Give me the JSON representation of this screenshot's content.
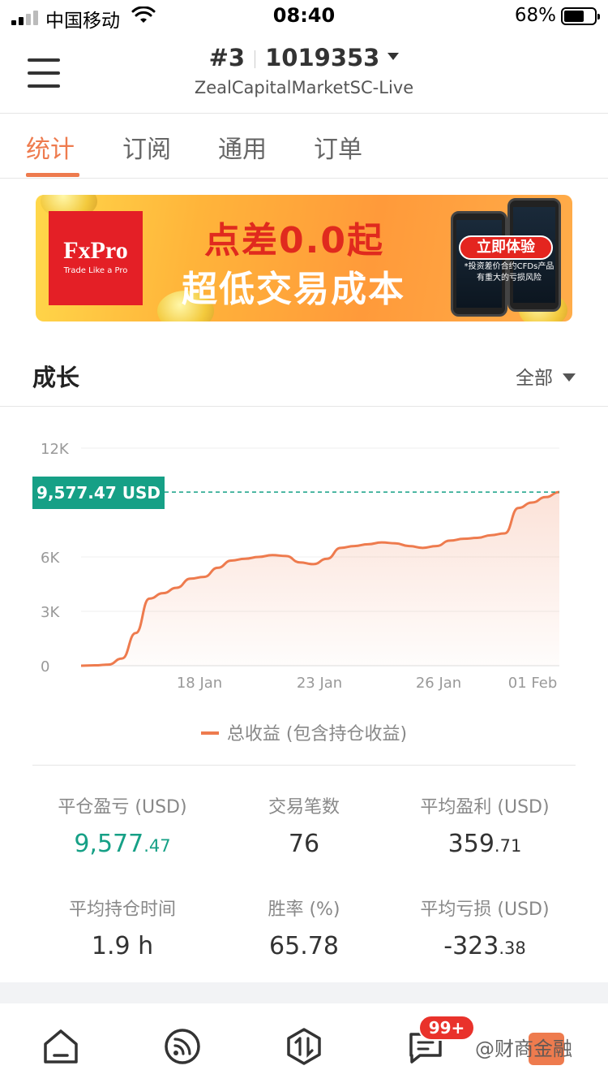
{
  "status_bar": {
    "carrier": "中国移动",
    "time": "08:40",
    "battery": "68%",
    "battery_level": 0.68,
    "signal_bars": 2
  },
  "header": {
    "account_index": "#3",
    "account_number": "1019353",
    "server": "ZealCapitalMarketSC-Live"
  },
  "tabs": [
    {
      "label": "统计",
      "active": true
    },
    {
      "label": "订阅",
      "active": false
    },
    {
      "label": "通用",
      "active": false
    },
    {
      "label": "订单",
      "active": false
    }
  ],
  "banner": {
    "brand": "FxPro",
    "brand_tagline": "Trade Like a Pro",
    "headline": "点差0.0起",
    "subheadline": "超低交易成本",
    "cta": "立即体验",
    "disclaimer": "*投资差价合约CFDs产品有重大的亏损风险"
  },
  "growth": {
    "title": "成长",
    "filter": "全部"
  },
  "chart_data": {
    "type": "area",
    "current_value_label": "9,577.47 USD",
    "current_value": 9577.47,
    "y_ticks": [
      "12K",
      "6K",
      "3K",
      "0"
    ],
    "ylim": [
      0,
      12000
    ],
    "x_ticks": [
      "18 Jan",
      "23 Jan",
      "26 Jan",
      "01 Feb"
    ],
    "series": [
      {
        "name": "总收益 (包含持仓收益)",
        "color": "#ee7b4e",
        "values": [
          0,
          20,
          60,
          400,
          1800,
          3700,
          4000,
          4300,
          4800,
          4900,
          5400,
          5800,
          5900,
          6000,
          6100,
          6050,
          5700,
          5600,
          5900,
          6500,
          6600,
          6700,
          6800,
          6750,
          6600,
          6500,
          6600,
          6900,
          7000,
          7050,
          7200,
          7300,
          8700,
          9000,
          9300,
          9577
        ]
      }
    ],
    "grid": true
  },
  "legend_label": "总收益 (包含持仓收益)",
  "stats": [
    {
      "label": "平仓盈亏 (USD)",
      "int": "9,577",
      "dec": ".47",
      "green": true
    },
    {
      "label": "交易笔数",
      "int": "76",
      "dec": "",
      "green": false
    },
    {
      "label": "平均盈利 (USD)",
      "int": "359",
      "dec": ".71",
      "green": false
    },
    {
      "label": "平均持仓时间",
      "int": "1.9 h",
      "dec": "",
      "green": false
    },
    {
      "label": "胜率 (%)",
      "int": "65.78",
      "dec": "",
      "green": false
    },
    {
      "label": "平均亏损 (USD)",
      "int": "-323",
      "dec": ".38",
      "green": false
    }
  ],
  "bottom_nav": {
    "badge": "99+",
    "watermark": "@财商金融"
  },
  "colors": {
    "accent": "#ee7b4e",
    "green": "#16a086"
  }
}
